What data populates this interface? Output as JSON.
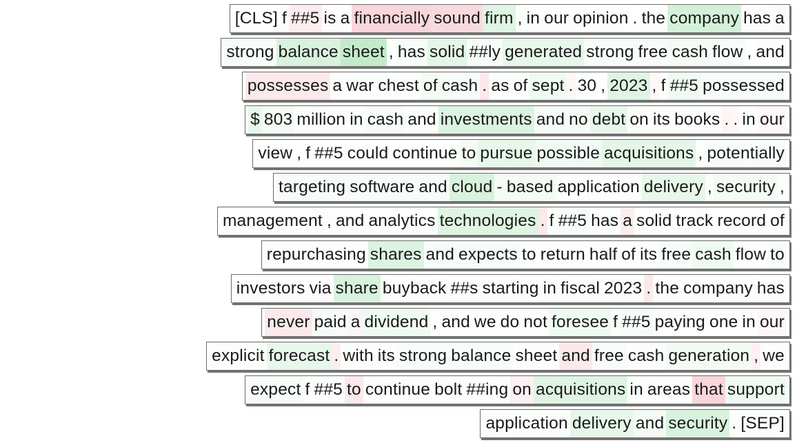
{
  "lines": [
    {
      "tokens": [
        {
          "t": "[CLS]",
          "s": 0
        },
        {
          "t": "f",
          "s": 0.05
        },
        {
          "t": "##5",
          "s": -0.25
        },
        {
          "t": "is",
          "s": -0.05
        },
        {
          "t": "a",
          "s": 0.05
        },
        {
          "t": "financially",
          "s": -0.55
        },
        {
          "t": "sound",
          "s": -0.5
        },
        {
          "t": "firm",
          "s": 0.4
        },
        {
          "t": ",",
          "s": 0.05
        },
        {
          "t": "in",
          "s": 0.05
        },
        {
          "t": "our",
          "s": 0.05
        },
        {
          "t": "opinion",
          "s": 0.05
        },
        {
          "t": ".",
          "s": 0
        },
        {
          "t": "the",
          "s": 0.05
        },
        {
          "t": "company",
          "s": 0.55
        },
        {
          "t": "has",
          "s": -0.05
        },
        {
          "t": "a",
          "s": 0.1
        }
      ]
    },
    {
      "tokens": [
        {
          "t": "strong",
          "s": 0.1
        },
        {
          "t": "balance",
          "s": 0.5
        },
        {
          "t": "sheet",
          "s": 0.75
        },
        {
          "t": ",",
          "s": 0.05
        },
        {
          "t": "has",
          "s": 0.1
        },
        {
          "t": "solid",
          "s": 0.35
        },
        {
          "t": "##ly",
          "s": 0.1
        },
        {
          "t": "generated",
          "s": 0.3
        },
        {
          "t": "strong",
          "s": 0.1
        },
        {
          "t": "free",
          "s": 0.1
        },
        {
          "t": "cash",
          "s": 0.15
        },
        {
          "t": "flow",
          "s": 0.1
        },
        {
          "t": ",",
          "s": 0
        },
        {
          "t": "and",
          "s": 0.05
        }
      ]
    },
    {
      "tokens": [
        {
          "t": "possesses",
          "s": -0.3
        },
        {
          "t": "a",
          "s": -0.05
        },
        {
          "t": "war",
          "s": 0.05
        },
        {
          "t": "chest",
          "s": 0.05
        },
        {
          "t": "of",
          "s": 0.15
        },
        {
          "t": "cash",
          "s": 0.1
        },
        {
          "t": ".",
          "s": -0.3
        },
        {
          "t": "as",
          "s": 0.05
        },
        {
          "t": "of",
          "s": 0.05
        },
        {
          "t": "sept",
          "s": 0.2
        },
        {
          "t": ".",
          "s": -0.1
        },
        {
          "t": "30",
          "s": 0.05
        },
        {
          "t": ",",
          "s": 0.05
        },
        {
          "t": "2023",
          "s": 0.4
        },
        {
          "t": ",",
          "s": -0.1
        },
        {
          "t": "f",
          "s": 0.05
        },
        {
          "t": "##5",
          "s": 0.2
        },
        {
          "t": "possessed",
          "s": 0.1
        }
      ]
    },
    {
      "tokens": [
        {
          "t": "$",
          "s": 0.3
        },
        {
          "t": "803",
          "s": 0.15
        },
        {
          "t": "million",
          "s": 0.05
        },
        {
          "t": "in",
          "s": 0.05
        },
        {
          "t": "cash",
          "s": 0.1
        },
        {
          "t": "and",
          "s": 0.05
        },
        {
          "t": "investments",
          "s": 0.45
        },
        {
          "t": "and",
          "s": 0.1
        },
        {
          "t": "no",
          "s": 0.1
        },
        {
          "t": "debt",
          "s": 0.3
        },
        {
          "t": "on",
          "s": 0.05
        },
        {
          "t": "its",
          "s": 0.05
        },
        {
          "t": "books",
          "s": 0.05
        },
        {
          "t": ".",
          "s": -0.15
        },
        {
          "t": ".",
          "s": -0.1
        },
        {
          "t": "in",
          "s": 0.05
        },
        {
          "t": "our",
          "s": -0.1
        }
      ]
    },
    {
      "tokens": [
        {
          "t": "view",
          "s": 0.05
        },
        {
          "t": ",",
          "s": 0.05
        },
        {
          "t": "f",
          "s": 0.05
        },
        {
          "t": "##5",
          "s": 0.05
        },
        {
          "t": "could",
          "s": 0.05
        },
        {
          "t": "continue",
          "s": 0.05
        },
        {
          "t": "to",
          "s": 0.15
        },
        {
          "t": "pursue",
          "s": 0.3
        },
        {
          "t": "possible",
          "s": 0.2
        },
        {
          "t": "acquisitions",
          "s": 0.35
        },
        {
          "t": ",",
          "s": 0.05
        },
        {
          "t": "potentially",
          "s": 0.1
        }
      ]
    },
    {
      "tokens": [
        {
          "t": "targeting",
          "s": 0.1
        },
        {
          "t": "software",
          "s": 0.1
        },
        {
          "t": "and",
          "s": 0.1
        },
        {
          "t": "cloud",
          "s": 0.5
        },
        {
          "t": "-",
          "s": 0.15
        },
        {
          "t": "based",
          "s": 0.15
        },
        {
          "t": "application",
          "s": 0.05
        },
        {
          "t": "delivery",
          "s": 0.3
        },
        {
          "t": ",",
          "s": 0.05
        },
        {
          "t": "security",
          "s": 0.15
        },
        {
          "t": ",",
          "s": 0.05
        }
      ]
    },
    {
      "tokens": [
        {
          "t": "management",
          "s": 0.05
        },
        {
          "t": ",",
          "s": 0.05
        },
        {
          "t": "and",
          "s": 0.05
        },
        {
          "t": "analytics",
          "s": 0.05
        },
        {
          "t": "technologies",
          "s": 0.4
        },
        {
          "t": ".",
          "s": -0.3
        },
        {
          "t": "f",
          "s": 0.05
        },
        {
          "t": "##5",
          "s": 0.1
        },
        {
          "t": "has",
          "s": 0.05
        },
        {
          "t": "a",
          "s": -0.25
        },
        {
          "t": "solid",
          "s": 0.05
        },
        {
          "t": "track",
          "s": 0.05
        },
        {
          "t": "record",
          "s": 0.05
        },
        {
          "t": "of",
          "s": 0.05
        }
      ]
    },
    {
      "tokens": [
        {
          "t": "repurchasing",
          "s": 0.05
        },
        {
          "t": "shares",
          "s": 0.45
        },
        {
          "t": "and",
          "s": 0.1
        },
        {
          "t": "expects",
          "s": 0.1
        },
        {
          "t": "to",
          "s": 0.05
        },
        {
          "t": "return",
          "s": 0.05
        },
        {
          "t": "half",
          "s": 0.05
        },
        {
          "t": "of",
          "s": 0.05
        },
        {
          "t": "its",
          "s": 0.05
        },
        {
          "t": "free",
          "s": 0.1
        },
        {
          "t": "cash",
          "s": 0.2
        },
        {
          "t": "flow",
          "s": 0.05
        },
        {
          "t": "to",
          "s": 0.1
        }
      ]
    },
    {
      "tokens": [
        {
          "t": "investors",
          "s": 0.05
        },
        {
          "t": "via",
          "s": -0.05
        },
        {
          "t": "share",
          "s": 0.5
        },
        {
          "t": "buyback",
          "s": 0.05
        },
        {
          "t": "##s",
          "s": -0.05
        },
        {
          "t": "starting",
          "s": 0.05
        },
        {
          "t": "in",
          "s": 0.05
        },
        {
          "t": "fiscal",
          "s": 0.05
        },
        {
          "t": "2023",
          "s": 0.05
        },
        {
          "t": ".",
          "s": -0.3
        },
        {
          "t": "the",
          "s": 0.05
        },
        {
          "t": "company",
          "s": 0.05
        },
        {
          "t": "has",
          "s": 0.05
        }
      ]
    },
    {
      "tokens": [
        {
          "t": "never",
          "s": -0.3
        },
        {
          "t": "paid",
          "s": 0.1
        },
        {
          "t": "a",
          "s": -0.15
        },
        {
          "t": "dividend",
          "s": 0.2
        },
        {
          "t": ",",
          "s": 0.05
        },
        {
          "t": "and",
          "s": 0.05
        },
        {
          "t": "we",
          "s": 0.05
        },
        {
          "t": "do",
          "s": 0.05
        },
        {
          "t": "not",
          "s": 0.05
        },
        {
          "t": "foresee",
          "s": 0.2
        },
        {
          "t": "f",
          "s": 0.05
        },
        {
          "t": "##5",
          "s": 0.1
        },
        {
          "t": "paying",
          "s": 0.05
        },
        {
          "t": "one",
          "s": 0.05
        },
        {
          "t": "in",
          "s": 0.05
        },
        {
          "t": "our",
          "s": -0.1
        }
      ]
    },
    {
      "tokens": [
        {
          "t": "explicit",
          "s": 0.05
        },
        {
          "t": "forecast",
          "s": 0.3
        },
        {
          "t": ".",
          "s": -0.25
        },
        {
          "t": "with",
          "s": 0.05
        },
        {
          "t": "its",
          "s": 0.05
        },
        {
          "t": "strong",
          "s": 0.1
        },
        {
          "t": "balance",
          "s": 0.1
        },
        {
          "t": "sheet",
          "s": 0.05
        },
        {
          "t": "and",
          "s": -0.3
        },
        {
          "t": "free",
          "s": 0.1
        },
        {
          "t": "cash",
          "s": 0.05
        },
        {
          "t": "generation",
          "s": 0.15
        },
        {
          "t": ",",
          "s": -0.2
        },
        {
          "t": "we",
          "s": 0.05
        }
      ]
    },
    {
      "tokens": [
        {
          "t": "expect",
          "s": 0.1
        },
        {
          "t": "f",
          "s": 0.05
        },
        {
          "t": "##5",
          "s": 0.05
        },
        {
          "t": "to",
          "s": -0.3
        },
        {
          "t": "continue",
          "s": 0.05
        },
        {
          "t": "bolt",
          "s": 0.05
        },
        {
          "t": "##ing",
          "s": 0.05
        },
        {
          "t": "on",
          "s": -0.2
        },
        {
          "t": "acquisitions",
          "s": 0.4
        },
        {
          "t": "in",
          "s": 0.05
        },
        {
          "t": "areas",
          "s": 0.05
        },
        {
          "t": "that",
          "s": -0.55
        },
        {
          "t": "support",
          "s": 0.2
        }
      ]
    },
    {
      "tokens": [
        {
          "t": "application",
          "s": 0.05
        },
        {
          "t": "delivery",
          "s": 0.3
        },
        {
          "t": "and",
          "s": 0.15
        },
        {
          "t": "security",
          "s": 0.5
        },
        {
          "t": ".",
          "s": 0.05
        },
        {
          "t": "[SEP]",
          "s": 0.05
        }
      ]
    }
  ],
  "colors": {
    "positive": "#2eb84a",
    "negative": "#dc3c50"
  }
}
